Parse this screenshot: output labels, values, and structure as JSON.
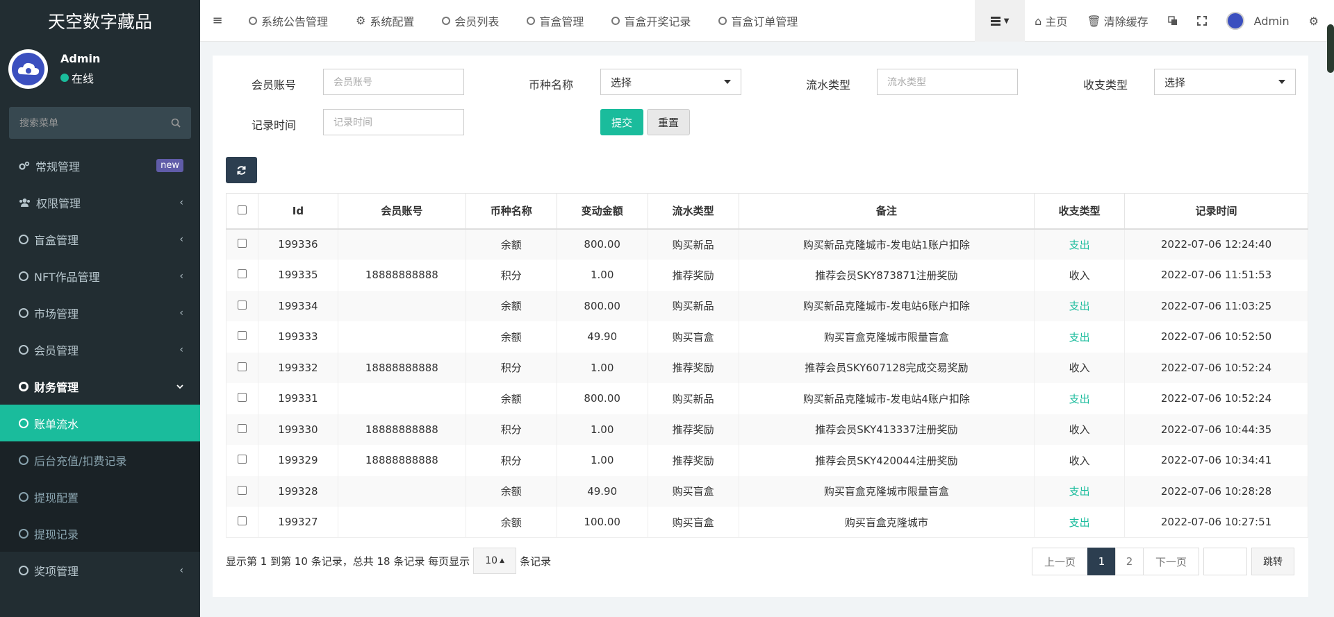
{
  "app": {
    "title": "天空数字藏品"
  },
  "user": {
    "name": "Admin",
    "status": "在线"
  },
  "sidebar": {
    "search_placeholder": "搜索菜单",
    "items": [
      {
        "label": "常规管理",
        "badge": "new"
      },
      {
        "label": "权限管理"
      },
      {
        "label": "盲盒管理"
      },
      {
        "label": "NFT作品管理"
      },
      {
        "label": "市场管理"
      },
      {
        "label": "会员管理"
      },
      {
        "label": "财务管理"
      },
      {
        "label": "账单流水"
      },
      {
        "label": "后台充值/扣费记录"
      },
      {
        "label": "提现配置"
      },
      {
        "label": "提现记录"
      },
      {
        "label": "奖项管理"
      }
    ]
  },
  "header": {
    "tabs": [
      "系统公告管理",
      "系统配置",
      "会员列表",
      "盲盒管理",
      "盲盒开奖记录",
      "盲盒订单管理"
    ],
    "home": "主页",
    "clear_cache": "清除缓存",
    "admin": "Admin"
  },
  "filters": {
    "member_account": {
      "label": "会员账号",
      "placeholder": "会员账号"
    },
    "currency": {
      "label": "币种名称",
      "value": "选择"
    },
    "flow_type": {
      "label": "流水类型",
      "placeholder": "流水类型"
    },
    "io_type": {
      "label": "收支类型",
      "value": "选择"
    },
    "record_time": {
      "label": "记录时间",
      "placeholder": "记录时间"
    },
    "submit": "提交",
    "reset": "重置"
  },
  "table": {
    "columns": [
      "Id",
      "会员账号",
      "币种名称",
      "变动金额",
      "流水类型",
      "备注",
      "收支类型",
      "记录时间"
    ],
    "rows": [
      [
        "199336",
        "",
        "余额",
        "800.00",
        "购买新品",
        "购买新品克隆城市-发电站1账户扣除",
        "支出",
        "2022-07-06 12:24:40"
      ],
      [
        "199335",
        "18888888888",
        "积分",
        "1.00",
        "推荐奖励",
        "推荐会员SKY873871注册奖励",
        "收入",
        "2022-07-06 11:51:53"
      ],
      [
        "199334",
        "",
        "余额",
        "800.00",
        "购买新品",
        "购买新品克隆城市-发电站6账户扣除",
        "支出",
        "2022-07-06 11:03:25"
      ],
      [
        "199333",
        "",
        "余额",
        "49.90",
        "购买盲盒",
        "购买盲盒克隆城市限量盲盒",
        "支出",
        "2022-07-06 10:52:50"
      ],
      [
        "199332",
        "18888888888",
        "积分",
        "1.00",
        "推荐奖励",
        "推荐会员SKY607128完成交易奖励",
        "收入",
        "2022-07-06 10:52:24"
      ],
      [
        "199331",
        "",
        "余额",
        "800.00",
        "购买新品",
        "购买新品克隆城市-发电站4账户扣除",
        "支出",
        "2022-07-06 10:52:24"
      ],
      [
        "199330",
        "18888888888",
        "积分",
        "1.00",
        "推荐奖励",
        "推荐会员SKY413337注册奖励",
        "收入",
        "2022-07-06 10:44:35"
      ],
      [
        "199329",
        "18888888888",
        "积分",
        "1.00",
        "推荐奖励",
        "推荐会员SKY420044注册奖励",
        "收入",
        "2022-07-06 10:34:41"
      ],
      [
        "199328",
        "",
        "余额",
        "49.90",
        "购买盲盒",
        "购买盲盒克隆城市限量盲盒",
        "支出",
        "2022-07-06 10:28:28"
      ],
      [
        "199327",
        "",
        "余额",
        "100.00",
        "购买盲盒",
        "购买盲盒克隆城市",
        "支出",
        "2022-07-06 10:27:51"
      ]
    ]
  },
  "footer": {
    "summary": "显示第 1 到第 10 条记录，总共 18 条记录 每页显示",
    "page_size": "10",
    "suffix": "条记录"
  },
  "pager": {
    "prev": "上一页",
    "pages": [
      "1",
      "2"
    ],
    "next": "下一页",
    "jump": "跳转"
  },
  "colors": {
    "accent": "#1abc9c",
    "sidebar_bg": "#222d32",
    "dark_btn": "#2c3e50",
    "badge": "#605ca8"
  }
}
